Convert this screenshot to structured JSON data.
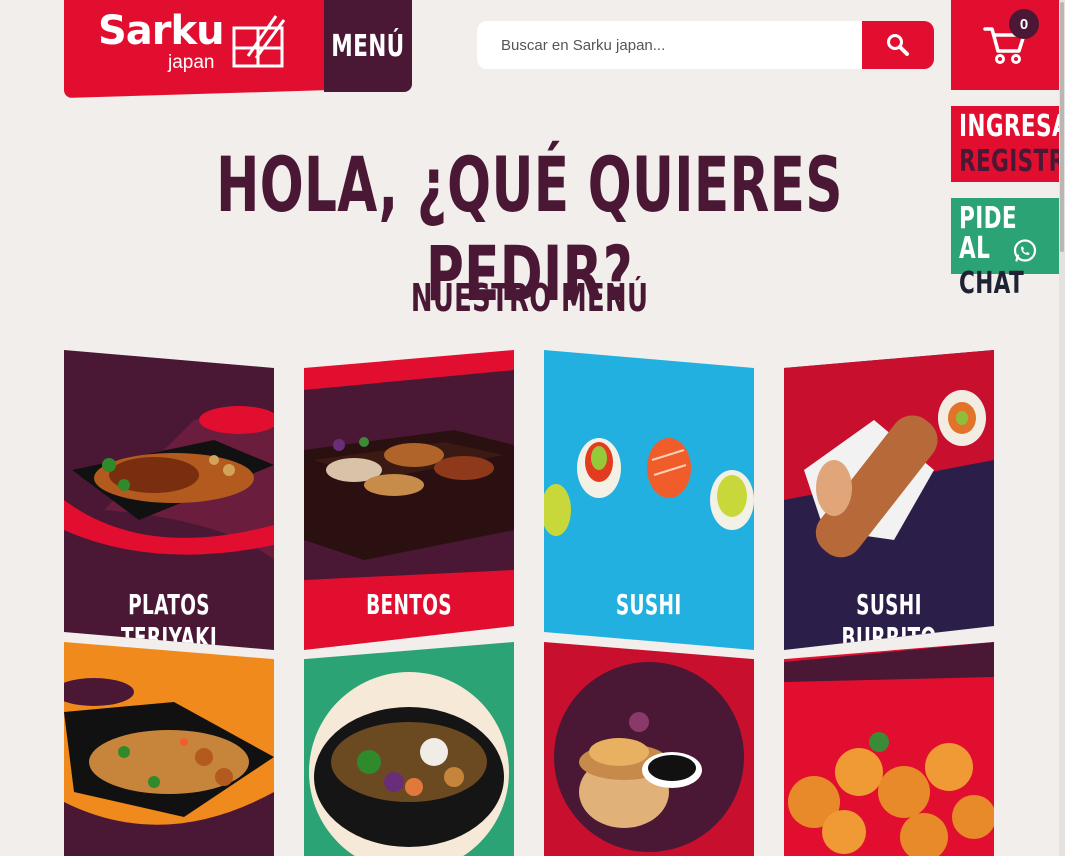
{
  "brand": {
    "name": "Sarku",
    "sub": "japan"
  },
  "header": {
    "menu_label": "MENÚ",
    "search_placeholder": "Buscar en Sarku japan...",
    "cart_count": "0"
  },
  "side": {
    "login_label": "INGRESAR",
    "register_label": "REGISTRO",
    "chat_line1": "PIDE AL",
    "chat_line2": "CHAT"
  },
  "hero": {
    "title": "HOLA, ¿QUÉ QUIERES PEDIR?"
  },
  "section": {
    "title": "NUESTRO MENÚ"
  },
  "categories": [
    {
      "label": "PLATOS TERIYAKI",
      "color": "#4a1834"
    },
    {
      "label": "BENTOS",
      "color": "#e20e2f"
    },
    {
      "label": "SUSHI",
      "color": "#22b0e0"
    },
    {
      "label": "SUSHI BURRITO",
      "color": "#2b1f4a"
    },
    {
      "label": "",
      "color": "#f08a1c"
    },
    {
      "label": "",
      "color": "#2ba374"
    },
    {
      "label": "",
      "color": "#c8102e"
    },
    {
      "label": "",
      "color": "#e20e2f"
    }
  ],
  "colors": {
    "brand_red": "#e20e2f",
    "brand_purple": "#4a1834",
    "whatsapp_green": "#2ba374",
    "background": "#f1eeeb"
  }
}
